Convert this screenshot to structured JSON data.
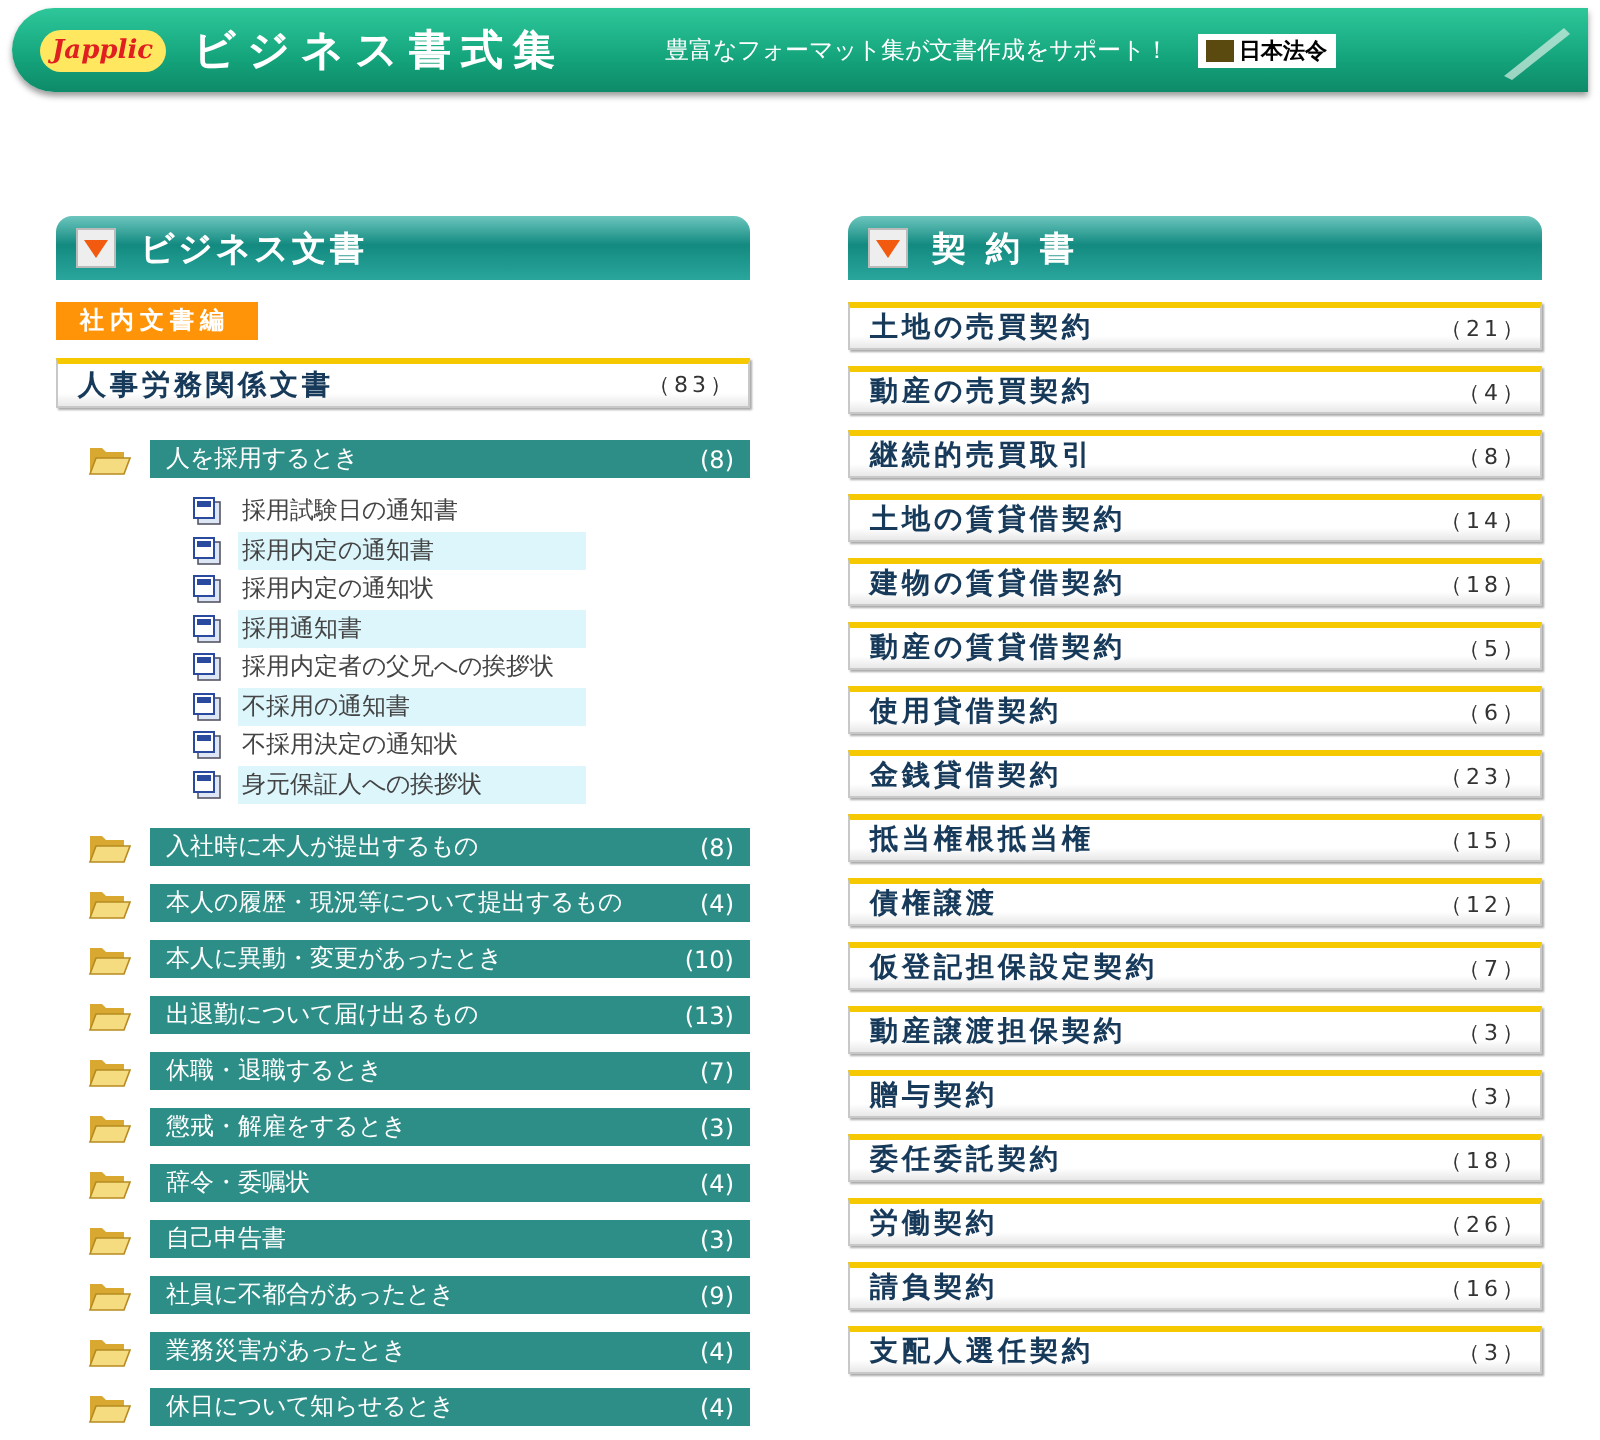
{
  "header": {
    "logo": "Japplic",
    "title": "ビジネス書式集",
    "tagline": "豊富なフォーマット集が文書作成をサポート！",
    "publisher": "日本法令"
  },
  "business_documents": {
    "title": "ビジネス文書",
    "subsection": "社内文書編",
    "category": {
      "label": "人事労務関係文書",
      "count": "（83）"
    },
    "folders": [
      {
        "label": "人を採用するとき",
        "count": "(8)",
        "documents": [
          "採用試験日の通知書",
          "採用内定の通知書",
          "採用内定の通知状",
          "採用通知書",
          "採用内定者の父兄への挨拶状",
          "不採用の通知書",
          "不採用決定の通知状",
          "身元保証人への挨拶状"
        ]
      },
      {
        "label": "入社時に本人が提出するもの",
        "count": "(8)"
      },
      {
        "label": "本人の履歴・現況等について提出するもの",
        "count": "(4)"
      },
      {
        "label": "本人に異動・変更があったとき",
        "count": "(10)"
      },
      {
        "label": "出退勤について届け出るもの",
        "count": "(13)"
      },
      {
        "label": "休職・退職するとき",
        "count": "(7)"
      },
      {
        "label": "懲戒・解雇をするとき",
        "count": "(3)"
      },
      {
        "label": "辞令・委嘱状",
        "count": "(4)"
      },
      {
        "label": "自己申告書",
        "count": "(3)"
      },
      {
        "label": "社員に不都合があったとき",
        "count": "(9)"
      },
      {
        "label": "業務災害があったとき",
        "count": "(4)"
      },
      {
        "label": "休日について知らせるとき",
        "count": "(4)"
      }
    ]
  },
  "contracts": {
    "title": "契 約 書",
    "items": [
      {
        "label": "土地の売買契約",
        "count": "（21）"
      },
      {
        "label": "動産の売買契約",
        "count": "（4）"
      },
      {
        "label": "継続的売買取引",
        "count": "（8）"
      },
      {
        "label": "土地の賃貸借契約",
        "count": "（14）"
      },
      {
        "label": "建物の賃貸借契約",
        "count": "（18）"
      },
      {
        "label": "動産の賃貸借契約",
        "count": "（5）"
      },
      {
        "label": "使用貸借契約",
        "count": "（6）"
      },
      {
        "label": "金銭貸借契約",
        "count": "（23）"
      },
      {
        "label": "抵当権根抵当権",
        "count": "（15）"
      },
      {
        "label": "債権譲渡",
        "count": "（12）"
      },
      {
        "label": "仮登記担保設定契約",
        "count": "（7）"
      },
      {
        "label": "動産譲渡担保契約",
        "count": "（3）"
      },
      {
        "label": "贈与契約",
        "count": "（3）"
      },
      {
        "label": "委任委託契約",
        "count": "（18）"
      },
      {
        "label": "労働契約",
        "count": "（26）"
      },
      {
        "label": "請負契約",
        "count": "（16）"
      },
      {
        "label": "支配人選任契約",
        "count": "（3）"
      }
    ]
  }
}
